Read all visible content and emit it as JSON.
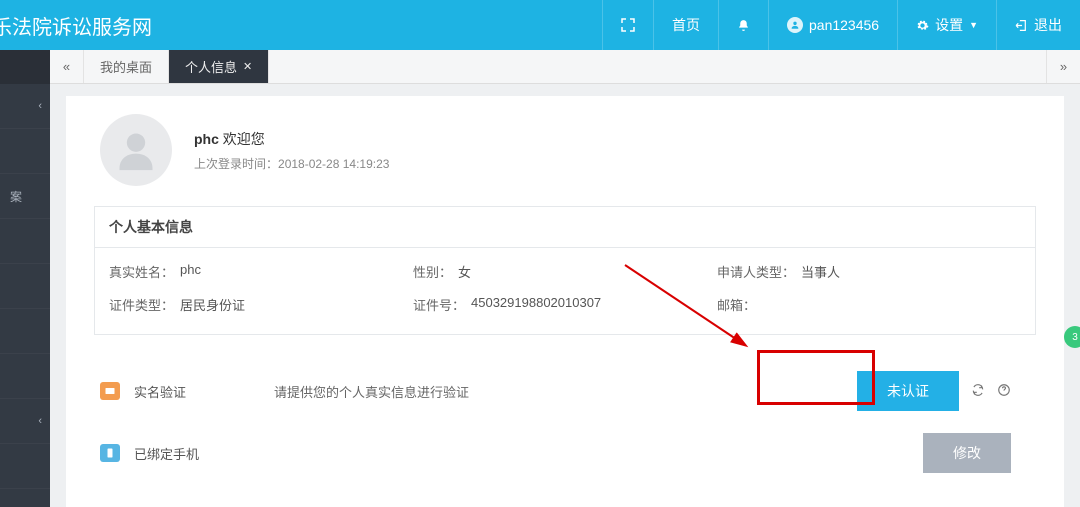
{
  "header": {
    "site_title": "乐法院诉讼服务网",
    "home": "首页",
    "username": "pan123456",
    "settings": "设置",
    "logout": "退出"
  },
  "tabs": {
    "desktop": "我的桌面",
    "profile": "个人信息"
  },
  "sidebar": {
    "items": [
      {
        "label": ""
      },
      {
        "label": ""
      },
      {
        "label": "案"
      },
      {
        "label": ""
      },
      {
        "label": ""
      },
      {
        "label": ""
      },
      {
        "label": ""
      },
      {
        "label": ""
      },
      {
        "label": ""
      }
    ]
  },
  "profile": {
    "name": "phc",
    "welcome_suffix": "欢迎您",
    "last_login_label": "上次登录时间：",
    "last_login_value": "2018-02-28 14:19:23"
  },
  "info": {
    "section_title": "个人基本信息",
    "real_name_label": "真实姓名：",
    "real_name_value": "phc",
    "gender_label": "性别：",
    "gender_value": "女",
    "applicant_type_label": "申请人类型：",
    "applicant_type_value": "当事人",
    "id_type_label": "证件类型：",
    "id_type_value": "居民身份证",
    "id_number_label": "证件号：",
    "id_number_value": "450329198802010307",
    "email_label": "邮箱：",
    "email_value": ""
  },
  "actions": {
    "verify_label": "实名验证",
    "verify_desc": "请提供您的个人真实信息进行验证",
    "verify_button": "未认证",
    "phone_label": "已绑定手机",
    "phone_button": "修改"
  }
}
